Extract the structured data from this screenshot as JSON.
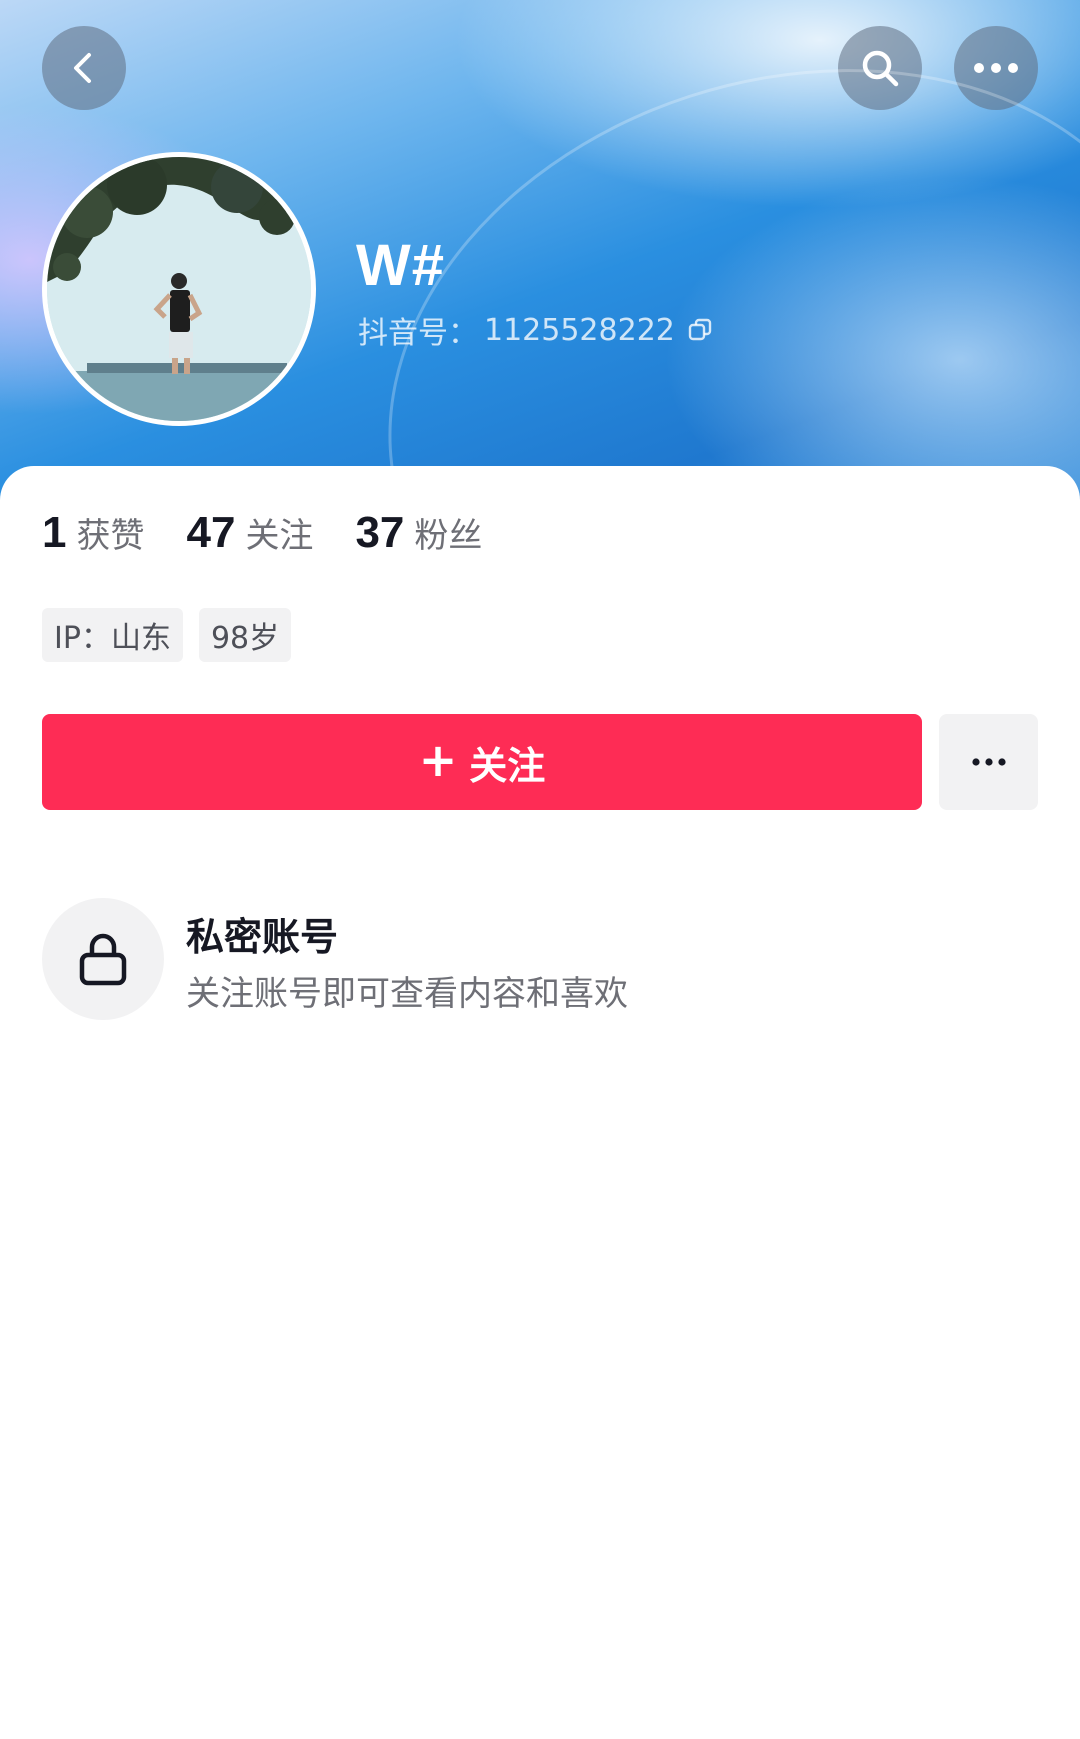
{
  "header": {
    "back_icon": "chevron-left-icon",
    "search_icon": "search-icon",
    "more_icon": "more-horizontal-icon"
  },
  "profile": {
    "nickname": "W#",
    "douyin_id_label": "抖音号：",
    "douyin_id": "1125528222",
    "copy_icon": "copy-icon"
  },
  "stats": [
    {
      "value": "1",
      "label": "获赞"
    },
    {
      "value": "47",
      "label": "关注"
    },
    {
      "value": "37",
      "label": "粉丝"
    }
  ],
  "tags": {
    "ip": "IP：山东",
    "age": "98岁"
  },
  "actions": {
    "follow_plus": "+",
    "follow_label": "关注",
    "more_icon": "more-horizontal-icon"
  },
  "private": {
    "icon": "lock-icon",
    "title": "私密账号",
    "description": "关注账号即可查看内容和喜欢"
  },
  "colors": {
    "follow_button": "#fe2c55",
    "banner_blue": "#2a8fe0",
    "text_primary": "#161823",
    "text_secondary": "#6e6f76"
  }
}
